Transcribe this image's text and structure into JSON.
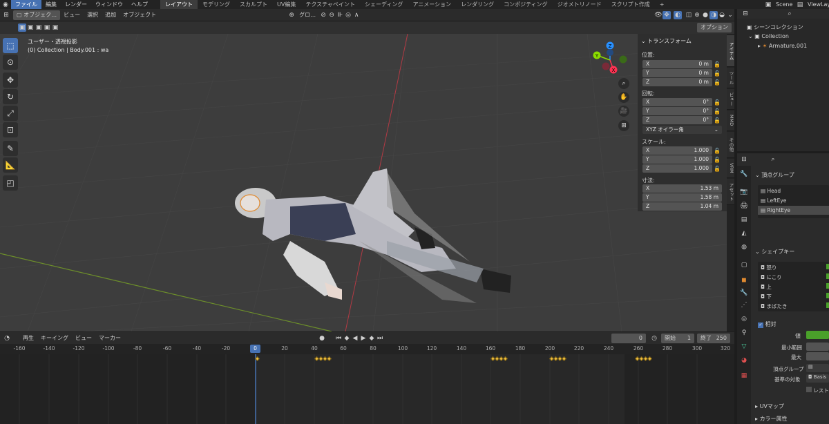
{
  "menus": [
    "ファイル",
    "編集",
    "レンダー",
    "ウィンドウ",
    "ヘルプ"
  ],
  "workspaces": [
    "レイアウト",
    "モデリング",
    "スカルプト",
    "UV編集",
    "テクスチャペイント",
    "シェーディング",
    "アニメーション",
    "レンダリング",
    "コンポジティング",
    "ジオメトリノード",
    "スクリプト作成",
    "+"
  ],
  "top_right": {
    "scene": "Scene",
    "layer": "ViewLayer"
  },
  "viewport_header": {
    "mode": "オブジェク…",
    "view": "ビュー",
    "select": "選択",
    "add": "追加",
    "object": "オブジェクト",
    "transform_orient": "グロ…",
    "options": "オプション"
  },
  "viewport": {
    "title": "ユーザー・透視投影",
    "subtitle": "(0) Collection | Body.001 : wa"
  },
  "gizmo": {
    "x": "X",
    "y": "Y",
    "z": "Z"
  },
  "npanel": {
    "section": "トランスフォーム",
    "location_label": "位置:",
    "location": [
      {
        "axis": "X",
        "value": "0 m"
      },
      {
        "axis": "Y",
        "value": "0 m"
      },
      {
        "axis": "Z",
        "value": "0 m"
      }
    ],
    "rotation_label": "回転:",
    "rotation": [
      {
        "axis": "X",
        "value": "0°"
      },
      {
        "axis": "Y",
        "value": "0°"
      },
      {
        "axis": "Z",
        "value": "0°"
      }
    ],
    "rotation_mode": "XYZ オイラー角",
    "scale_label": "スケール:",
    "scale": [
      {
        "axis": "X",
        "value": "1.000"
      },
      {
        "axis": "Y",
        "value": "1.000"
      },
      {
        "axis": "Z",
        "value": "1.000"
      }
    ],
    "dim_label": "寸法:",
    "dimensions": [
      {
        "axis": "X",
        "value": "1.53 m"
      },
      {
        "axis": "Y",
        "value": "1.58 m"
      },
      {
        "axis": "Z",
        "value": "1.04 m"
      }
    ]
  },
  "vtabs": [
    "アイテム",
    "ツール",
    "ビュー",
    "MMD",
    "その他",
    "VRM",
    "アセット"
  ],
  "outliner": {
    "scene_collection": "シーンコレクション",
    "collection": "Collection",
    "armature": "Armature.001"
  },
  "properties": {
    "vertex_groups_title": "頂点グループ",
    "vertex_groups": [
      "Head",
      "LeftEye",
      "RightEye"
    ],
    "shape_keys_title": "シェイプキー",
    "shape_keys": [
      "怒り",
      "にこり",
      "上",
      "下",
      "まばたき"
    ],
    "relative_label": "相対",
    "value_label": "値",
    "min_label": "最小範囲",
    "max_label": "最大",
    "vgroup_label": "頂点グループ",
    "relative_key_label": "基準の対象",
    "relative_key_value": "Basis",
    "rest_label": "レスト",
    "uv_maps": "UVマップ",
    "color_attr": "カラー属性"
  },
  "timeline": {
    "playback": "再生",
    "keying": "キーイング",
    "view": "ビュー",
    "marker": "マーカー",
    "current_frame": "0",
    "start_label": "開始",
    "start": "1",
    "end_label": "終了",
    "end": "250",
    "ticks": [
      "-160",
      "-140",
      "-120",
      "-100",
      "-80",
      "-60",
      "-40",
      "-20",
      "0",
      "20",
      "40",
      "60",
      "80",
      "100",
      "120",
      "140",
      "160",
      "180",
      "200",
      "220",
      "240",
      "260",
      "280",
      "300",
      "320"
    ],
    "playhead": "0"
  },
  "colors": {
    "accent": "#4772b3",
    "x_axis": "#ff3352",
    "y_axis": "#8bdc00",
    "z_axis": "#2890ff",
    "keyframe": "#f0c040"
  }
}
